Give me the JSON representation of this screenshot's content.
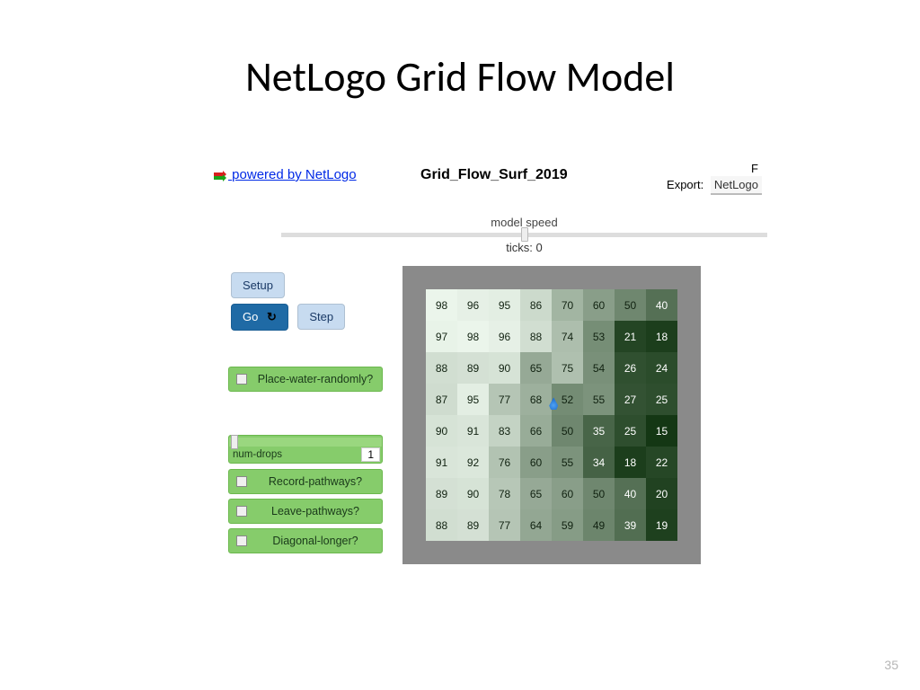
{
  "slide": {
    "title": "NetLogo Grid Flow Model",
    "page_number": "35"
  },
  "header": {
    "powered_link": "powered by NetLogo",
    "model_name": "Grid_Flow_Surf_2019",
    "f_stub": "F",
    "export_label": "Export:",
    "export_option": "NetLogo"
  },
  "speed": {
    "label": "model speed",
    "ticks": "ticks: 0"
  },
  "buttons": {
    "setup": "Setup",
    "go": "Go",
    "step": "Step"
  },
  "switches": {
    "place_water": "Place-water-randomly?",
    "record": "Record-pathways?",
    "leave": "Leave-pathways?",
    "diagonal": "Diagonal-longer?"
  },
  "slider": {
    "name": "num-drops",
    "value": "1"
  },
  "grid": {
    "rows": [
      [
        98,
        96,
        95,
        86,
        70,
        60,
        50,
        40
      ],
      [
        97,
        98,
        96,
        88,
        74,
        53,
        21,
        18
      ],
      [
        88,
        89,
        90,
        65,
        75,
        54,
        26,
        24
      ],
      [
        87,
        95,
        77,
        68,
        52,
        55,
        27,
        25
      ],
      [
        90,
        91,
        83,
        66,
        50,
        35,
        25,
        15
      ],
      [
        91,
        92,
        76,
        60,
        55,
        34,
        18,
        22
      ],
      [
        89,
        90,
        78,
        65,
        60,
        50,
        40,
        20
      ],
      [
        88,
        89,
        77,
        64,
        59,
        49,
        39,
        19
      ]
    ]
  }
}
